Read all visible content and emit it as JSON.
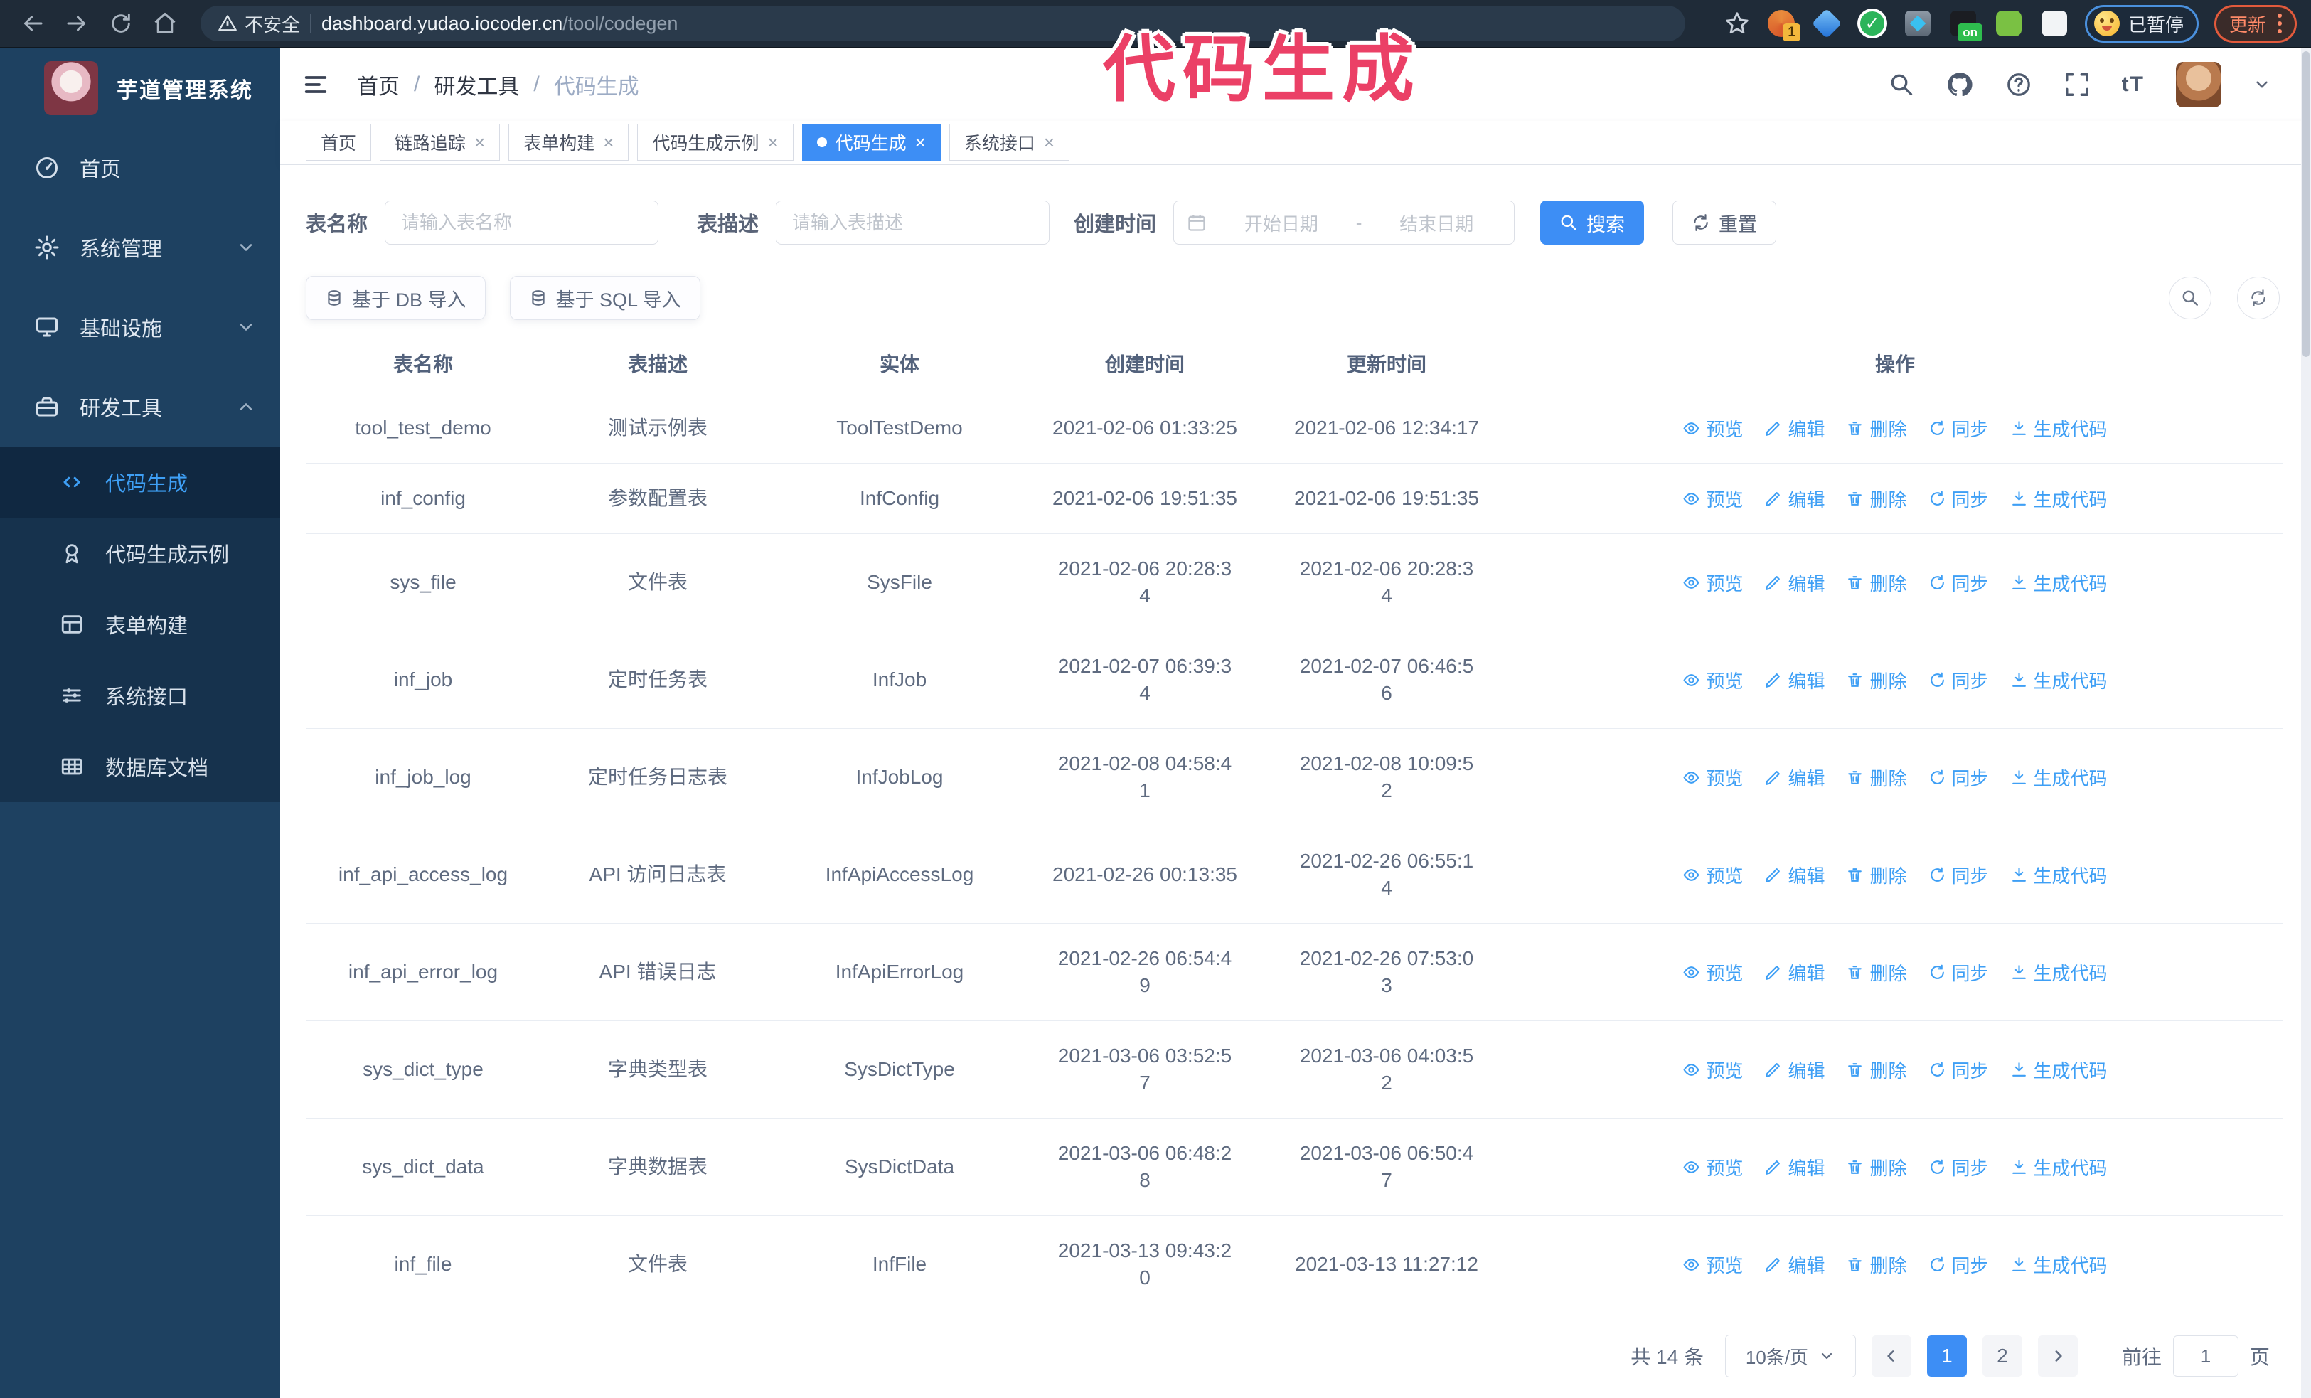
{
  "browser": {
    "security_label": "不安全",
    "url_host": "dashboard.yudao.iocoder.cn",
    "url_path": "/tool/codegen",
    "extension_icons": [
      "orange-extension-icon",
      "gem-extension-icon",
      "green-check-extension-icon",
      "grid-extension-icon",
      "dark-extension-icon",
      "robot-extension-icon",
      "puzzle-extension-icon"
    ],
    "ext_badge_count": "1",
    "ext_badge_on": "on",
    "paused_label": "已暂停",
    "update_label": "更新"
  },
  "overlay": {
    "annotation": "代码生成"
  },
  "sidebar": {
    "logo_title": "芋道管理系统",
    "menu": [
      {
        "label": "首页",
        "icon": "dashboard-icon",
        "arrow": ""
      },
      {
        "label": "系统管理",
        "icon": "gear-icon",
        "arrow": "down"
      },
      {
        "label": "基础设施",
        "icon": "monitor-icon",
        "arrow": "down"
      },
      {
        "label": "研发工具",
        "icon": "toolbox-icon",
        "arrow": "up"
      }
    ],
    "submenu": [
      {
        "label": "代码生成",
        "icon": "code-icon",
        "active": true
      },
      {
        "label": "代码生成示例",
        "icon": "medal-icon",
        "active": false
      },
      {
        "label": "表单构建",
        "icon": "form-icon",
        "active": false
      },
      {
        "label": "系统接口",
        "icon": "sliders-icon",
        "active": false
      },
      {
        "label": "数据库文档",
        "icon": "database-icon",
        "active": false
      }
    ]
  },
  "header": {
    "breadcrumb": [
      "首页",
      "研发工具",
      "代码生成"
    ]
  },
  "tabs": [
    {
      "label": "首页",
      "closable": false,
      "active": false
    },
    {
      "label": "链路追踪",
      "closable": true,
      "active": false
    },
    {
      "label": "表单构建",
      "closable": true,
      "active": false
    },
    {
      "label": "代码生成示例",
      "closable": true,
      "active": false
    },
    {
      "label": "代码生成",
      "closable": true,
      "active": true
    },
    {
      "label": "系统接口",
      "closable": true,
      "active": false
    }
  ],
  "filters": {
    "table_name_label": "表名称",
    "table_name_placeholder": "请输入表名称",
    "table_desc_label": "表描述",
    "table_desc_placeholder": "请输入表描述",
    "create_time_label": "创建时间",
    "date_start_placeholder": "开始日期",
    "date_separator": "-",
    "date_end_placeholder": "结束日期",
    "search_button": "搜索",
    "reset_button": "重置"
  },
  "toolbar": {
    "import_db_button": "基于 DB 导入",
    "import_sql_button": "基于 SQL 导入"
  },
  "table": {
    "columns": [
      "表名称",
      "表描述",
      "实体",
      "创建时间",
      "更新时间",
      "操作"
    ],
    "actions": [
      "预览",
      "编辑",
      "删除",
      "同步",
      "生成代码"
    ],
    "rows": [
      {
        "name": "tool_test_demo",
        "desc": "测试示例表",
        "entity": "ToolTestDemo",
        "created": "2021-02-06 01:33:25",
        "updated": "2021-02-06 12:34:17"
      },
      {
        "name": "inf_config",
        "desc": "参数配置表",
        "entity": "InfConfig",
        "created": "2021-02-06 19:51:35",
        "updated": "2021-02-06 19:51:35"
      },
      {
        "name": "sys_file",
        "desc": "文件表",
        "entity": "SysFile",
        "created": "2021-02-06 20:28:3\n4",
        "updated": "2021-02-06 20:28:3\n4"
      },
      {
        "name": "inf_job",
        "desc": "定时任务表",
        "entity": "InfJob",
        "created": "2021-02-07 06:39:3\n4",
        "updated": "2021-02-07 06:46:5\n6"
      },
      {
        "name": "inf_job_log",
        "desc": "定时任务日志表",
        "entity": "InfJobLog",
        "created": "2021-02-08 04:58:4\n1",
        "updated": "2021-02-08 10:09:5\n2"
      },
      {
        "name": "inf_api_access_log",
        "desc": "API 访问日志表",
        "entity": "InfApiAccessLog",
        "created": "2021-02-26 00:13:35",
        "updated": "2021-02-26 06:55:1\n4"
      },
      {
        "name": "inf_api_error_log",
        "desc": "API 错误日志",
        "entity": "InfApiErrorLog",
        "created": "2021-02-26 06:54:4\n9",
        "updated": "2021-02-26 07:53:0\n3"
      },
      {
        "name": "sys_dict_type",
        "desc": "字典类型表",
        "entity": "SysDictType",
        "created": "2021-03-06 03:52:5\n7",
        "updated": "2021-03-06 04:03:5\n2"
      },
      {
        "name": "sys_dict_data",
        "desc": "字典数据表",
        "entity": "SysDictData",
        "created": "2021-03-06 06:48:2\n8",
        "updated": "2021-03-06 06:50:4\n7"
      },
      {
        "name": "inf_file",
        "desc": "文件表",
        "entity": "InfFile",
        "created": "2021-03-13 09:43:2\n0",
        "updated": "2021-03-13 11:27:12"
      }
    ]
  },
  "pagination": {
    "total": "共 14 条",
    "page_size": "10条/页",
    "pages": [
      "1",
      "2"
    ],
    "active_page": "1",
    "goto_label": "前往",
    "goto_value": "1",
    "goto_unit": "页"
  }
}
